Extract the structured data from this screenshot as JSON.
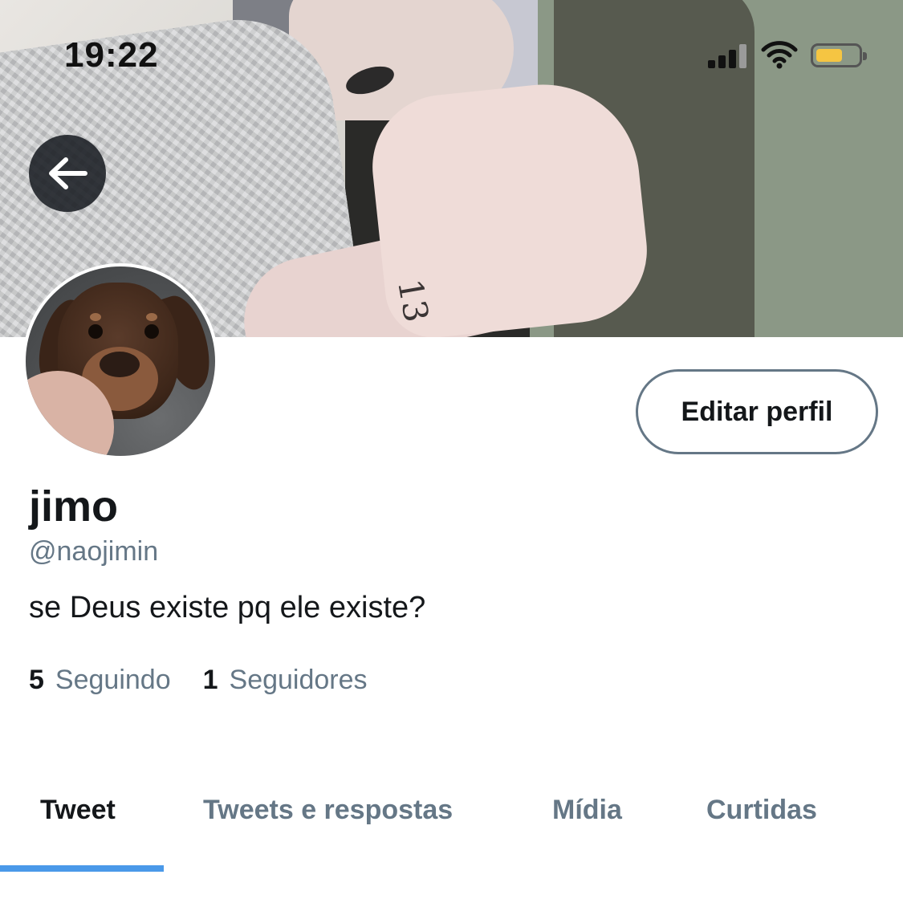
{
  "status_bar": {
    "time": "19:22",
    "signal_icon": "cellular-signal-icon",
    "wifi_icon": "wifi-icon",
    "battery_icon": "battery-icon",
    "battery_color": "#f5c542"
  },
  "header": {
    "back_icon": "arrow-left-icon"
  },
  "profile": {
    "display_name": "jimo",
    "handle": "@naojimin",
    "bio": "se Deus existe pq ele existe?",
    "edit_button_label": "Editar perfil",
    "stats": {
      "following_count": "5",
      "following_label": "Seguindo",
      "followers_count": "1",
      "followers_label": "Seguidores"
    }
  },
  "tabs": [
    {
      "label": "Tweet",
      "active": true
    },
    {
      "label": "Tweets e respostas",
      "active": false
    },
    {
      "label": "Mídia",
      "active": false
    },
    {
      "label": "Curtidas",
      "active": false
    }
  ],
  "colors": {
    "accent": "#4a99e9",
    "secondary_text": "#657786",
    "primary_text": "#14171a"
  }
}
